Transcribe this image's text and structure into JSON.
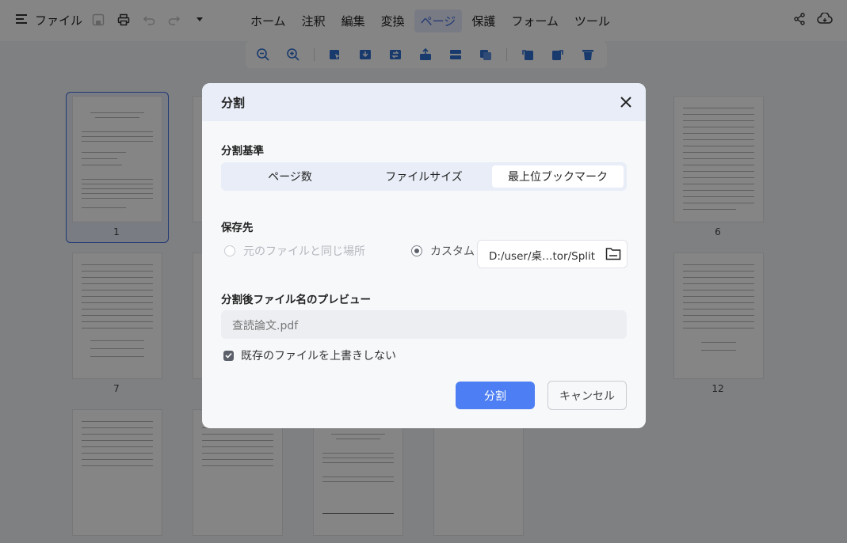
{
  "topbar": {
    "file_label": "ファイル",
    "menu_items": [
      "ホーム",
      "注釈",
      "編集",
      "変換",
      "ページ",
      "保護",
      "フォーム",
      "ツール"
    ],
    "active_menu": "ページ"
  },
  "thumbnails": {
    "labels": [
      "1",
      "6",
      "7",
      "12"
    ]
  },
  "dialog": {
    "title": "分割",
    "criteria_label": "分割基準",
    "segments": [
      "ページ数",
      "ファイルサイズ",
      "最上位ブックマーク"
    ],
    "active_segment": "最上位ブックマーク",
    "save_label": "保存先",
    "option_same": "元のファイルと同じ場所",
    "option_custom": "カスタム",
    "path_value": "D:/user/桌…tor/Split",
    "preview_label": "分割後ファイル名のプレビュー",
    "preview_value": "查読論文.pdf",
    "no_overwrite_label": "既存のファイルを上書きしない",
    "split_button": "分割",
    "cancel_button": "キャンセル"
  },
  "colors": {
    "accent": "#4e7ef3",
    "overlay": "rgba(0,0,0,0.48)"
  }
}
